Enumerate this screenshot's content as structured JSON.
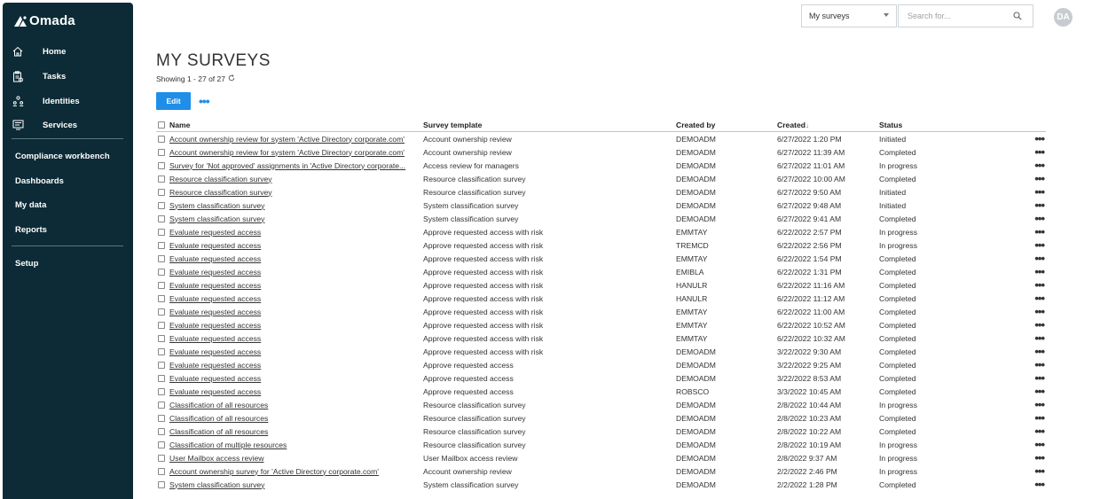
{
  "app": {
    "brand": "Omada"
  },
  "sidebar": {
    "nav": [
      {
        "label": "Home",
        "icon": "home-icon"
      },
      {
        "label": "Tasks",
        "icon": "tasks-icon"
      },
      {
        "label": "Identities",
        "icon": "identities-icon"
      },
      {
        "label": "Services",
        "icon": "services-icon"
      }
    ],
    "links": [
      "Compliance workbench",
      "Dashboards",
      "My data",
      "Reports"
    ],
    "setup": "Setup"
  },
  "topbar": {
    "scope_value": "My surveys",
    "search_placeholder": "Search for...",
    "avatar_initials": "DA"
  },
  "page": {
    "title": "MY SURVEYS",
    "showing": "Showing 1 - 27 of 27",
    "edit_label": "Edit",
    "more_label": "•••"
  },
  "table": {
    "columns": [
      "Name",
      "Survey template",
      "Created by",
      "Created",
      "Status"
    ],
    "sorted_column": "Created",
    "sort_direction": "descending",
    "row_action_label": "•••",
    "rows": [
      {
        "name": "Account ownership review for system 'Active Directory corporate.com'",
        "template": "Account ownership review",
        "by": "DEMOADM",
        "created": "6/27/2022 1:20 PM",
        "status": "Initiated"
      },
      {
        "name": "Account ownership review for system 'Active Directory corporate.com'",
        "template": "Account ownership review",
        "by": "DEMOADM",
        "created": "6/27/2022 11:39 AM",
        "status": "Completed"
      },
      {
        "name": "Survey for 'Not approved' assignments in 'Active Directory corporate...",
        "template": "Access review for managers",
        "by": "DEMOADM",
        "created": "6/27/2022 11:01 AM",
        "status": "In progress"
      },
      {
        "name": "Resource classification survey",
        "template": "Resource classification survey",
        "by": "DEMOADM",
        "created": "6/27/2022 10:00 AM",
        "status": "Completed"
      },
      {
        "name": "Resource classification survey",
        "template": "Resource classification survey",
        "by": "DEMOADM",
        "created": "6/27/2022 9:50 AM",
        "status": "Initiated"
      },
      {
        "name": "System classification survey",
        "template": "System classification survey",
        "by": "DEMOADM",
        "created": "6/27/2022 9:48 AM",
        "status": "Initiated"
      },
      {
        "name": "System classification survey",
        "template": "System classification survey",
        "by": "DEMOADM",
        "created": "6/27/2022 9:41 AM",
        "status": "Completed"
      },
      {
        "name": "Evaluate requested access",
        "template": "Approve requested access with risk",
        "by": "EMMTAY",
        "created": "6/22/2022 2:57 PM",
        "status": "In progress"
      },
      {
        "name": "Evaluate requested access",
        "template": "Approve requested access with risk",
        "by": "TREMCD",
        "created": "6/22/2022 2:56 PM",
        "status": "In progress"
      },
      {
        "name": "Evaluate requested access",
        "template": "Approve requested access with risk",
        "by": "EMMTAY",
        "created": "6/22/2022 1:54 PM",
        "status": "Completed"
      },
      {
        "name": "Evaluate requested access",
        "template": "Approve requested access with risk",
        "by": "EMIBLA",
        "created": "6/22/2022 1:31 PM",
        "status": "Completed"
      },
      {
        "name": "Evaluate requested access",
        "template": "Approve requested access with risk",
        "by": "HANULR",
        "created": "6/22/2022 11:16 AM",
        "status": "Completed"
      },
      {
        "name": "Evaluate requested access",
        "template": "Approve requested access with risk",
        "by": "HANULR",
        "created": "6/22/2022 11:12 AM",
        "status": "Completed"
      },
      {
        "name": "Evaluate requested access",
        "template": "Approve requested access with risk",
        "by": "EMMTAY",
        "created": "6/22/2022 11:00 AM",
        "status": "Completed"
      },
      {
        "name": "Evaluate requested access",
        "template": "Approve requested access with risk",
        "by": "EMMTAY",
        "created": "6/22/2022 10:52 AM",
        "status": "Completed"
      },
      {
        "name": "Evaluate requested access",
        "template": "Approve requested access with risk",
        "by": "EMMTAY",
        "created": "6/22/2022 10:32 AM",
        "status": "Completed"
      },
      {
        "name": "Evaluate requested access",
        "template": "Approve requested access with risk",
        "by": "DEMOADM",
        "created": "3/22/2022 9:30 AM",
        "status": "Completed"
      },
      {
        "name": "Evaluate requested access",
        "template": "Approve requested access",
        "by": "DEMOADM",
        "created": "3/22/2022 9:25 AM",
        "status": "Completed"
      },
      {
        "name": "Evaluate requested access",
        "template": "Approve requested access",
        "by": "DEMOADM",
        "created": "3/22/2022 8:53 AM",
        "status": "Completed"
      },
      {
        "name": "Evaluate requested access",
        "template": "Approve requested access",
        "by": "ROBSCO",
        "created": "3/3/2022 10:45 AM",
        "status": "Completed"
      },
      {
        "name": "Classification of all resources",
        "template": "Resource classification survey",
        "by": "DEMOADM",
        "created": "2/8/2022 10:44 AM",
        "status": "In progress"
      },
      {
        "name": "Classification of all resources",
        "template": "Resource classification survey",
        "by": "DEMOADM",
        "created": "2/8/2022 10:23 AM",
        "status": "Completed"
      },
      {
        "name": "Classification of all resources",
        "template": "Resource classification survey",
        "by": "DEMOADM",
        "created": "2/8/2022 10:22 AM",
        "status": "Completed"
      },
      {
        "name": "Classification of multiple resources",
        "template": "Resource classification survey",
        "by": "DEMOADM",
        "created": "2/8/2022 10:19 AM",
        "status": "In progress"
      },
      {
        "name": "User Mailbox access review",
        "template": "User Mailbox access review",
        "by": "DEMOADM",
        "created": "2/8/2022 9:37 AM",
        "status": "In progress"
      },
      {
        "name": "Account ownership survey for 'Active Directory corporate.com'",
        "template": "Account ownership review",
        "by": "DEMOADM",
        "created": "2/2/2022 2:46 PM",
        "status": "In progress"
      },
      {
        "name": "System classification survey",
        "template": "System classification survey",
        "by": "DEMOADM",
        "created": "2/2/2022 1:28 PM",
        "status": "Completed"
      }
    ]
  },
  "colors": {
    "sidebar_bg": "#0d2b36",
    "accent": "#1f8ee8",
    "avatar_bg": "#c7ccd1"
  }
}
